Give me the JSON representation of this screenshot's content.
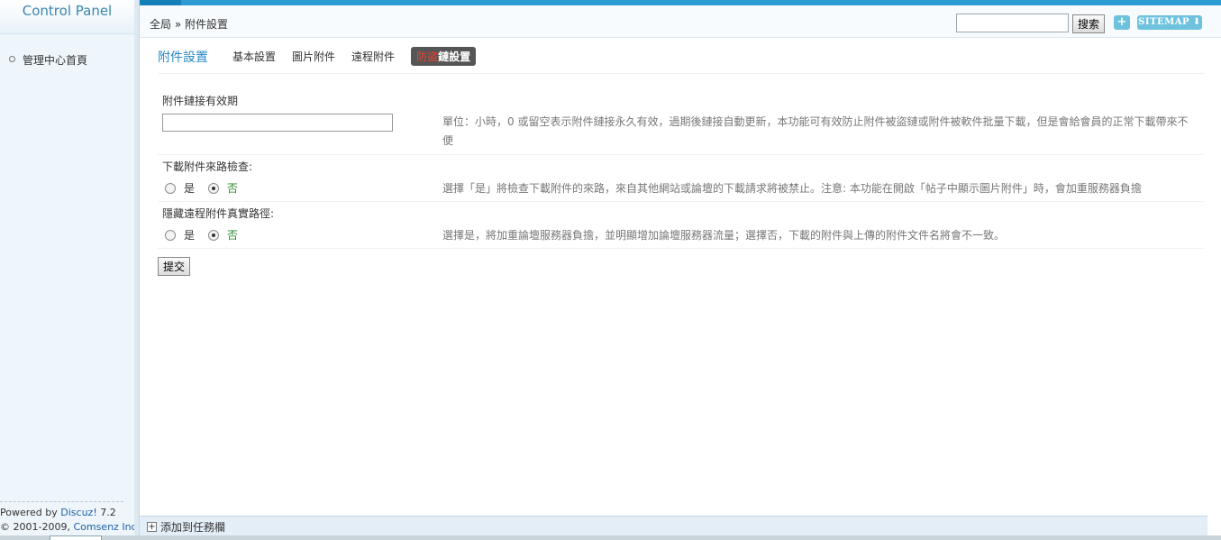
{
  "sidebar": {
    "title": "Control Panel",
    "items": [
      {
        "label": "管理中心首頁"
      }
    ],
    "footer": {
      "powered_prefix": "Powered by ",
      "powered_link": "Discuz!",
      "version": " 7.2",
      "copyright_prefix": "© 2001-2009, ",
      "copyright_link": "Comsenz Inc."
    }
  },
  "header": {
    "breadcrumb": "全局 » 附件設置",
    "search": {
      "value": "",
      "button_label": "搜索"
    },
    "plus_label": "+",
    "sitemap_label": "SITEMAP ⬇"
  },
  "tabs": {
    "title": "附件設置",
    "items": [
      {
        "label": "基本設置"
      },
      {
        "label": "圖片附件"
      },
      {
        "label": "遠程附件"
      }
    ],
    "active": {
      "label_red": "防盜",
      "label_rest": "鏈設置"
    }
  },
  "settings": [
    {
      "label": "附件鏈接有效期",
      "value": "",
      "description": "單位：小時，0 或留空表示附件鏈接永久有效，過期後鏈接自動更新，本功能可有效防止附件被盜鏈或附件被軟件批量下載，但是會給會員的正常下載帶來不便"
    },
    {
      "label": "下載附件來路檢查:",
      "options": [
        "是",
        "否"
      ],
      "selected": "否",
      "description": "選擇「是」將檢查下載附件的來路，來自其他網站或論壇的下載請求將被禁止。注意: 本功能在開啟「帖子中顯示圖片附件」時，會加重服務器負擔"
    },
    {
      "label": "隱藏遠程附件真實路徑:",
      "options": [
        "是",
        "否"
      ],
      "selected": "否",
      "description": "選擇是，將加重論壇服務器負擔，並明顯增加論壇服務器流量；選擇否，下載的附件與上傳的附件文件名將會不一致。"
    }
  ],
  "submit_label": "提交",
  "taskbar": {
    "add_label": "添加到任務欄",
    "add_icon": "+"
  },
  "colors": {
    "accent": "#2b9bd1",
    "link": "#2a88c4",
    "active_tab_bg": "#555555",
    "highlight_red": "#ff3a2a"
  }
}
